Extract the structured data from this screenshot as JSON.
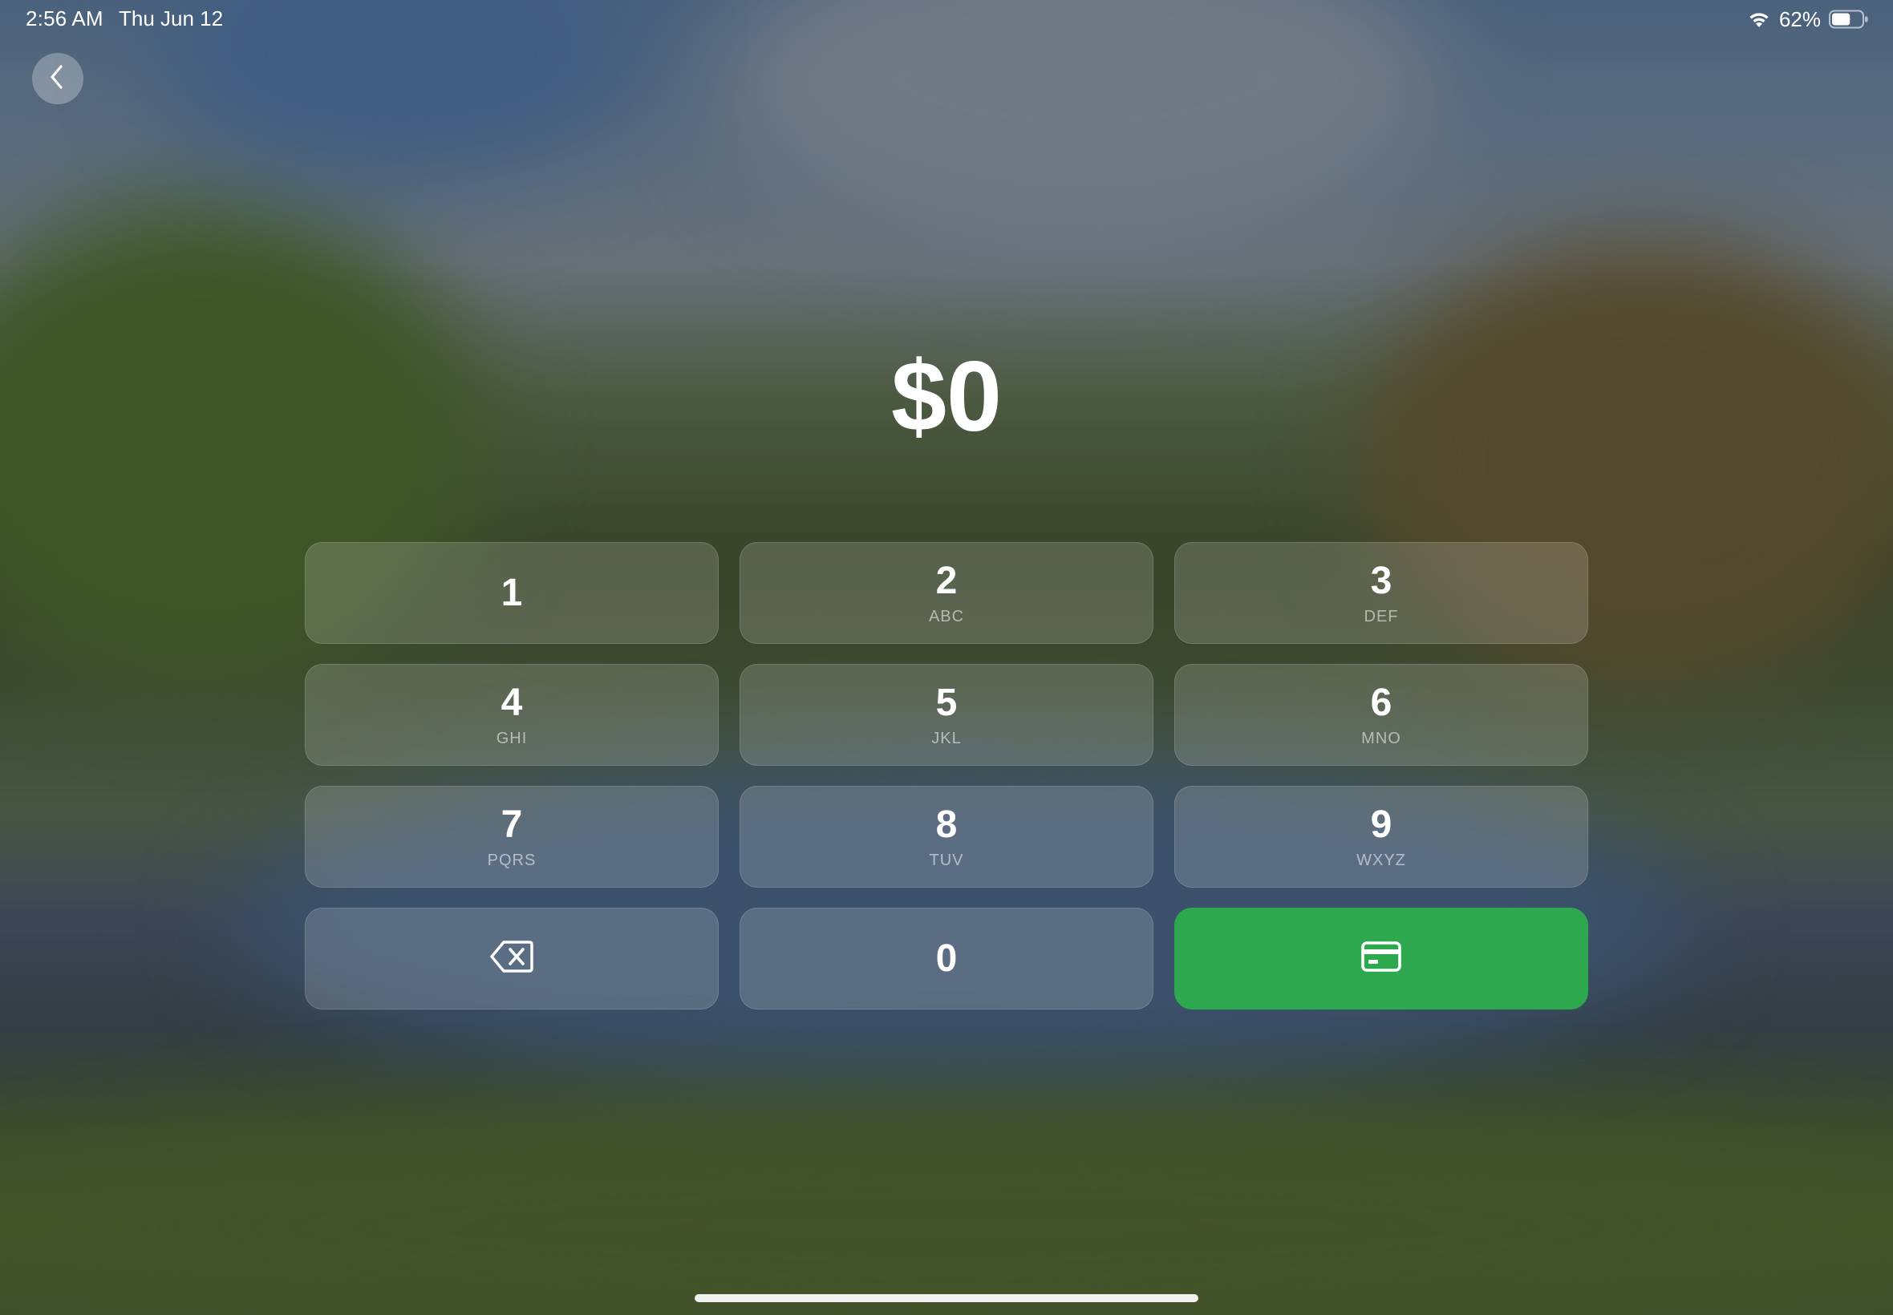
{
  "status_bar": {
    "time": "2:56 AM",
    "date": "Thu Jun 12",
    "battery_percent": "62%",
    "battery_level": 0.62,
    "wifi_icon": "wifi-icon",
    "battery_icon": "battery-icon"
  },
  "back_icon": "chevron-left-icon",
  "amount": "$0",
  "keypad": {
    "keys": [
      {
        "digit": "1",
        "letters": ""
      },
      {
        "digit": "2",
        "letters": "ABC"
      },
      {
        "digit": "3",
        "letters": "DEF"
      },
      {
        "digit": "4",
        "letters": "GHI"
      },
      {
        "digit": "5",
        "letters": "JKL"
      },
      {
        "digit": "6",
        "letters": "MNO"
      },
      {
        "digit": "7",
        "letters": "PQRS"
      },
      {
        "digit": "8",
        "letters": "TUV"
      },
      {
        "digit": "9",
        "letters": "WXYZ"
      }
    ],
    "delete_icon": "backspace-icon",
    "zero": "0",
    "charge_icon": "credit-card-icon",
    "charge_color": "#2ea84f"
  }
}
